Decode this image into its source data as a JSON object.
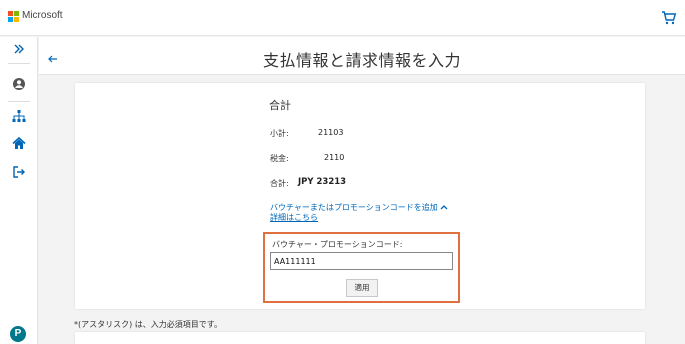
{
  "topbar": {
    "brand": "Microsoft"
  },
  "header": {
    "title": "支払情報と請求情報を入力"
  },
  "summary": {
    "title": "合計",
    "subtotal_label": "小計:",
    "subtotal_value": "21103",
    "tax_label": "税金:",
    "tax_value": "2110",
    "total_label": "合計:",
    "total_value": "JPY 23213"
  },
  "promo": {
    "add_link": "バウチャーまたはプロモーションコードを追加",
    "details_link": "詳細はこちら",
    "field_label": "バウチャー・プロモーションコード:",
    "field_value": "AA111111",
    "apply_label": "適用"
  },
  "note": "*(アスタリスク) は、入力必須項目です。",
  "colors": {
    "accent_link": "#0067b8",
    "highlight_box": "#e0703f",
    "pearson": "#00778a"
  },
  "icons": [
    "microsoft-logo",
    "cart-icon",
    "expand-icon",
    "user-icon",
    "org-chart-icon",
    "home-icon",
    "sign-out-icon",
    "back-arrow-icon",
    "chevron-up-icon",
    "pearson-logo"
  ]
}
